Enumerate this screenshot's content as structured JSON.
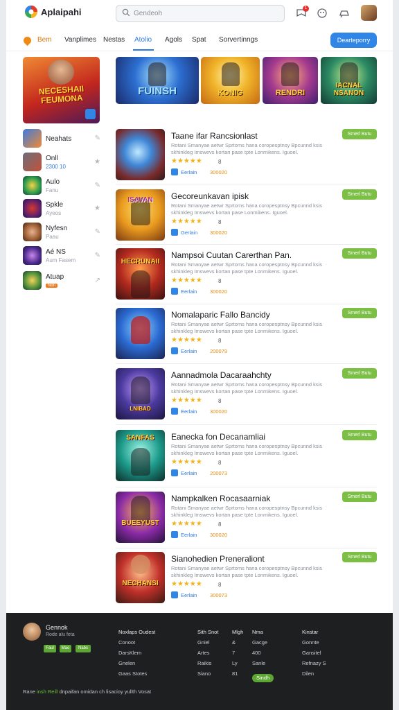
{
  "header": {
    "brand": "Aplaipahi",
    "search_placeholder": "Gendeoh",
    "notification_count": "1"
  },
  "nav": {
    "home": "Bem",
    "tabs": [
      "Vanplimes",
      "Nestas",
      "Atolio",
      "Agols",
      "Spat",
      "Sorvertinngs"
    ],
    "cta": "Dearteporry"
  },
  "hero": {
    "main_title": "NECESHAII FEUMONA",
    "banners": [
      "FUINSH",
      "KONIG",
      "RENDRI",
      "IACNAL NSANON"
    ]
  },
  "sidebar": {
    "items": [
      {
        "name": "Neahats",
        "sub": ""
      },
      {
        "name": "Onll",
        "sub": "2300 10"
      },
      {
        "name": "Aulo",
        "sub": "Fanu"
      },
      {
        "name": "Spkle",
        "sub": "Ayeos"
      },
      {
        "name": "Nyfesn",
        "sub": "Paau"
      },
      {
        "name": "Aé NS",
        "sub": "Aum Fasem"
      },
      {
        "name": "Atuap",
        "sub": "Ndn"
      }
    ]
  },
  "apps": [
    {
      "title": "Taane ifar Rancsionlast",
      "desc": "Rotani Smanyae aetwr Sprtoms hana coropesptnsy Bpcunnd ksis skhinkleg Imswevs kortan pase tpte Lonmikens. Iguoel.",
      "rating": "8",
      "meta_label": "Eerlain",
      "meta_num": "300020",
      "install": "Smerl Butu",
      "thumb_text": ""
    },
    {
      "title": "Gecoreunkavan ipisk",
      "desc": "Rotani Smanyae aetwr Sprtoms hana coropesptnsy Bpcunnd ksis skhinkleg Imswevs kortan pase Lonmikens. Iguoel.",
      "rating": "8",
      "meta_label": "Gerlain",
      "meta_num": "300020",
      "install": "Smerl Butu",
      "thumb_text": "ISAVAN"
    },
    {
      "title": "Nampsoi Cuutan Carerthan Pan.",
      "desc": "Rotani Smanyae aetwr Sprtoms hana coropesptnsy Bpcunnd ksis skhinkleg Imswevs kortan pase tpte Lonmikens. Iguoel.",
      "rating": "8",
      "meta_label": "Eerlain",
      "meta_num": "300020",
      "install": "Smerl Butu",
      "thumb_text": "HECRUNAII"
    },
    {
      "title": "Nomalaparic Fallo Bancidy",
      "desc": "Rotani Smanyae aetwr Sprtoms hana coropesptnsy Bpcunnd ksis skhinkleg Imswevs kortan pase tpte Lonmikens. Iguoel.",
      "rating": "8",
      "meta_label": "Eerlain",
      "meta_num": "200079",
      "install": "Smerl Butu",
      "thumb_text": ""
    },
    {
      "title": "Aannadmola Dacaraahchty",
      "desc": "Rotani Smanyae aetwr Sprtoms hana coropesptnsy Bpcunnd ksis skhinkleg Imswevs kortan pase tpte Lonmikens. Iguoel.",
      "rating": "8",
      "meta_label": "Eerlain",
      "meta_num": "300020",
      "install": "Smerl Butu",
      "thumb_text": "LNIBAD"
    },
    {
      "title": "Eanecka fon Decanamliai",
      "desc": "Rotani Smanyae aetwr Sprtoms hana coropesptnsy Bpcunnd ksis skhinkleg Imswevs kortan pase tpte Lonmikens. Iguoel.",
      "rating": "8",
      "meta_label": "Eerlain",
      "meta_num": "200073",
      "install": "Smerl Butu",
      "thumb_text": "SANFAS"
    },
    {
      "title": "Nampkalken Rocasaarniak",
      "desc": "Rotani Smanyae aetwr Sprtoms hana coropesptnsy Bpcunnd ksis skhinkleg Imswevs kortan pase tpte Lonmikens. Iguoel.",
      "rating": "8",
      "meta_label": "Eerlain",
      "meta_num": "300020",
      "install": "Smerl Butu",
      "thumb_text": "BUEEYUST"
    },
    {
      "title": "Sianohedien Preneraliont",
      "desc": "Rotani Smanyae aetwr Sprtoms hana coropesptnsy Bpcunnd ksis skhinkleg Imswevs kortan pase tpte Lonmikens. Iguoel.",
      "rating": "8",
      "meta_label": "Eerlain",
      "meta_num": "300073",
      "install": "Smerl Butu",
      "thumb_text": "NECHANSI"
    }
  ],
  "footer": {
    "name": "Gennok",
    "sub": "Rode alu feta",
    "pills": [
      "Faul",
      "Mao",
      "Nabs"
    ],
    "col1": [
      "Noxlaps Oudest",
      "Conoot",
      "DarsKlern",
      "Gnelen",
      "Gaas Stotes"
    ],
    "col2": [
      "Sith Snot",
      "Gniel",
      "Artes",
      "Raikis",
      "Siano"
    ],
    "col3": [
      "Mlgh",
      "&",
      "7",
      "Ly",
      "81"
    ],
    "col4": [
      "Nma",
      "Gacge",
      "400",
      "Sanle",
      "Sindh"
    ],
    "col5": [
      "Kinstar",
      "Gonnte",
      "Gansitel",
      "Refnazy S",
      "Dilen"
    ],
    "bottom_pre": "Rane",
    "bottom_green": "insh Reill",
    "bottom_post": "dnpaifan omidan ch lisacioy yullth Vosat"
  },
  "colors": {
    "accent": "#2f7be0",
    "install": "#7bbf45",
    "stars": "#f2b21a",
    "footer_bg": "#1e1f21"
  }
}
